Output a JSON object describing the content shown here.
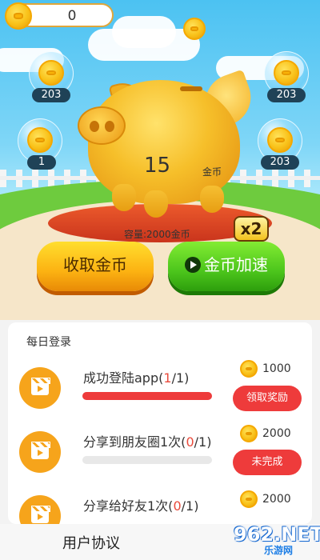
{
  "header": {
    "coin_balance": "0"
  },
  "bubbles": [
    {
      "value": "203"
    },
    {
      "value": "203"
    },
    {
      "value": "1"
    },
    {
      "value": "203"
    }
  ],
  "pig": {
    "coins": "15",
    "unit": "金币",
    "capacity": "容量:2000金币",
    "multiplier": "x2"
  },
  "actions": {
    "collect_label": "收取金币",
    "speed_label": "金币加速"
  },
  "tasks_section": {
    "title": "每日登录",
    "items": [
      {
        "name": "成功登陆app(",
        "done": "1",
        "total": "/1)",
        "progress": 1.0,
        "reward": "1000",
        "button": "领取奖励"
      },
      {
        "name": "分享到朋友圈1次(",
        "done": "0",
        "total": "/1)",
        "progress": 0.0,
        "reward": "2000",
        "button": "未完成"
      },
      {
        "name": "分享给好友1次(",
        "done": "0",
        "total": "/1)",
        "progress": 0.0,
        "reward": "2000",
        "button": ""
      }
    ]
  },
  "footer": {
    "agreement": "用户协议"
  },
  "watermark": {
    "brand": "962.NET",
    "sub": "乐游网"
  },
  "colors": {
    "accent_red": "#ee3b3b",
    "coin_gold": "#f9c21a",
    "action_green": "#4cc51c",
    "action_yellow": "#fcb212"
  }
}
